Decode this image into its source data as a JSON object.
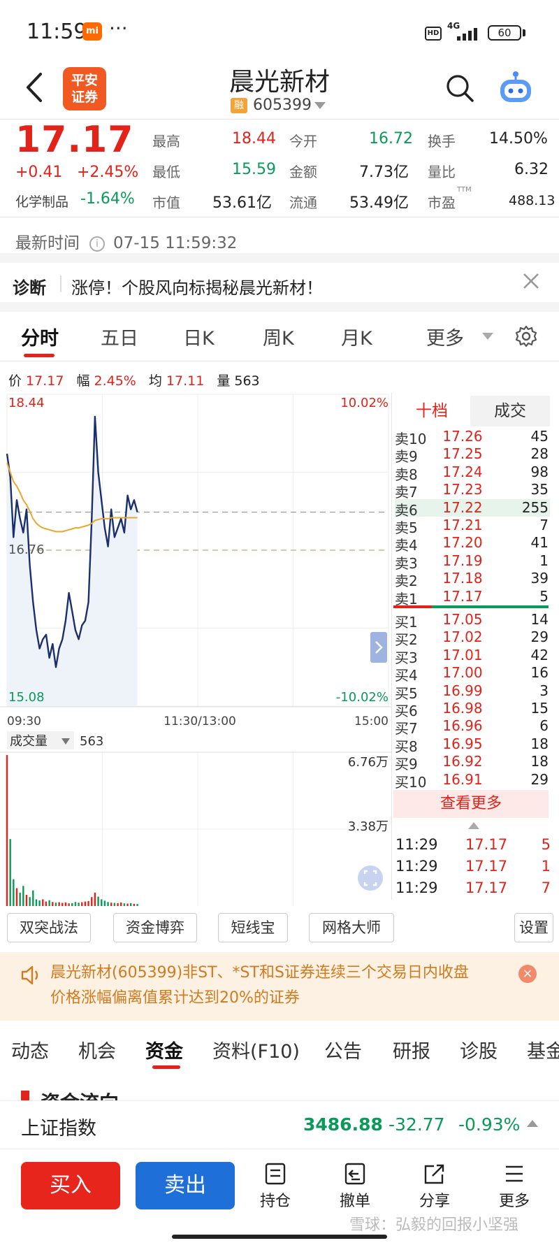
{
  "status_bar": {
    "time": "11:59",
    "mi": "mi",
    "hd": "HD",
    "net": "4G",
    "battery": "60"
  },
  "header": {
    "logo_line1": "平安",
    "logo_line2": "证券",
    "stock_name": "晨光新材",
    "rong_badge": "融",
    "stock_code": "605399"
  },
  "quote": {
    "price": "17.17",
    "change": "+0.41",
    "change_pct": "+2.45%",
    "sector_name": "化学制品",
    "sector_pct": "-1.64%",
    "fields": {
      "high_label": "最高",
      "high": "18.44",
      "low_label": "最低",
      "low": "15.59",
      "mcap_label": "市值",
      "mcap": "53.61亿",
      "open_label": "今开",
      "open": "16.72",
      "amount_label": "金额",
      "amount": "7.73亿",
      "float_label": "流通",
      "float": "53.49亿",
      "turnover_label": "换手",
      "turnover": "14.50%",
      "vol_ratio_label": "量比",
      "vol_ratio": "6.32",
      "pe_label": "市盈",
      "pe_sup": "TTM",
      "pe": "488.13"
    },
    "update_label": "最新时间",
    "update_time": "07-15 11:59:32"
  },
  "diagnosis": {
    "title": "诊断",
    "text": "涨停！个股风向标揭秘晨光新材！"
  },
  "chart_tabs": [
    "分时",
    "五日",
    "日K",
    "周K",
    "月K",
    "更多"
  ],
  "price_info": {
    "price_label": "价",
    "price": "17.17",
    "range_label": "幅",
    "range": "2.45%",
    "avg_label": "均",
    "avg": "17.11",
    "vol_label": "量",
    "vol": "563"
  },
  "chart": {
    "y_top": "18.44",
    "y_mid": "16.76",
    "y_bottom": "15.08",
    "pct_top": "10.02%",
    "pct_bottom": "-10.02%",
    "x_start": "09:30",
    "x_mid": "11:30/13:00",
    "x_end": "15:00",
    "volume_label": "成交量",
    "volume_value": "563",
    "vol_top": "6.76万",
    "vol_mid": "3.38万"
  },
  "chart_data": {
    "type": "line",
    "x_range": [
      "09:30",
      "15:00"
    ],
    "ylim": [
      15.08,
      18.44
    ],
    "prev_close": 16.76,
    "series": [
      {
        "values": [
          17.8,
          17.55,
          16.9,
          17.3,
          17.1,
          16.95,
          17.2,
          16.6,
          16.2,
          15.9,
          15.7,
          15.8,
          15.85,
          15.6,
          15.75,
          15.5,
          15.7,
          15.8,
          16.0,
          16.3,
          16.1,
          15.9,
          15.8,
          15.95,
          16.0,
          16.2,
          17.1,
          18.2,
          17.6,
          17.3,
          17.0,
          16.8,
          17.2,
          16.9,
          17.0,
          17.1,
          16.95,
          17.35,
          17.2,
          17.3,
          17.17
        ]
      },
      {
        "values": [
          17.7,
          17.6,
          17.5,
          17.45,
          17.38,
          17.3,
          17.25,
          17.18,
          17.1,
          17.05,
          17.02,
          17.0,
          16.99,
          16.98,
          16.97,
          16.96,
          16.96,
          16.96,
          16.97,
          16.98,
          16.99,
          17.0,
          17.0,
          17.01,
          17.02,
          17.03,
          17.05,
          17.08,
          17.09,
          17.1,
          17.1,
          17.1,
          17.11,
          17.11,
          17.11,
          17.11,
          17.11,
          17.11,
          17.11,
          17.11,
          17.11
        ]
      }
    ],
    "volume": [
      67600,
      30000,
      12000,
      8000,
      6000,
      9000,
      5000,
      4000,
      7000,
      3000,
      2500,
      3000,
      2000,
      2600,
      1800,
      1500,
      1700,
      1400,
      1600,
      1200,
      1300,
      1800,
      1500,
      1700,
      2000,
      2200,
      4000,
      6000,
      4200,
      3000,
      2400,
      1800,
      1500,
      1400,
      1300,
      1600,
      1200,
      1100,
      1300,
      1000,
      900
    ]
  },
  "order_book": {
    "tab_ten": "十档",
    "tab_deals": "成交",
    "asks": [
      {
        "label": "卖10",
        "price": "17.26",
        "vol": "45"
      },
      {
        "label": "卖9",
        "price": "17.25",
        "vol": "28"
      },
      {
        "label": "卖8",
        "price": "17.24",
        "vol": "98"
      },
      {
        "label": "卖7",
        "price": "17.23",
        "vol": "35"
      },
      {
        "label": "卖6",
        "price": "17.22",
        "vol": "255"
      },
      {
        "label": "卖5",
        "price": "17.21",
        "vol": "7"
      },
      {
        "label": "卖4",
        "price": "17.20",
        "vol": "41"
      },
      {
        "label": "卖3",
        "price": "17.19",
        "vol": "1"
      },
      {
        "label": "卖2",
        "price": "17.18",
        "vol": "39"
      },
      {
        "label": "卖1",
        "price": "17.17",
        "vol": "5"
      }
    ],
    "bids": [
      {
        "label": "买1",
        "price": "17.05",
        "vol": "14"
      },
      {
        "label": "买2",
        "price": "17.02",
        "vol": "29"
      },
      {
        "label": "买3",
        "price": "17.01",
        "vol": "42"
      },
      {
        "label": "买4",
        "price": "17.00",
        "vol": "16"
      },
      {
        "label": "买5",
        "price": "16.99",
        "vol": "3"
      },
      {
        "label": "买6",
        "price": "16.98",
        "vol": "15"
      },
      {
        "label": "买7",
        "price": "16.96",
        "vol": "6"
      },
      {
        "label": "买8",
        "price": "16.95",
        "vol": "18"
      },
      {
        "label": "买9",
        "price": "16.92",
        "vol": "18"
      },
      {
        "label": "买10",
        "price": "16.91",
        "vol": "29"
      }
    ],
    "see_more": "查看更多",
    "trades": [
      {
        "time": "11:29",
        "price": "17.17",
        "vol": "5"
      },
      {
        "time": "11:29",
        "price": "17.17",
        "vol": "1"
      },
      {
        "time": "11:29",
        "price": "17.17",
        "vol": "7"
      }
    ]
  },
  "tools": [
    "双突战法",
    "资金博弈",
    "短线宝",
    "网格大师"
  ],
  "settings_label": "设置",
  "notice": {
    "line1": "晨光新材(605399)非ST、*ST和S证券连续三个交易日内收盘",
    "line2": "价格涨幅偏离值累计达到20%的证券",
    "close": "×"
  },
  "section_tabs": [
    "动态",
    "机会",
    "资金",
    "资料(F10)",
    "公告",
    "研报",
    "诊股",
    "基金"
  ],
  "peek_title": "资金流向",
  "index_bar": {
    "name": "上证指数",
    "value": "3486.88",
    "change": "-32.77",
    "pct": "-0.93%"
  },
  "bottom": {
    "buy": "买入",
    "sell": "卖出",
    "hold": "持仓",
    "cancel": "撤单",
    "share": "分享",
    "more": "更多"
  },
  "watermark": "雪球：弘毅的回报小坚强",
  "colors": {
    "up": "#e2231a",
    "down": "#0a9a5a",
    "line": "#1a2f6b",
    "avg": "#e6a832"
  }
}
